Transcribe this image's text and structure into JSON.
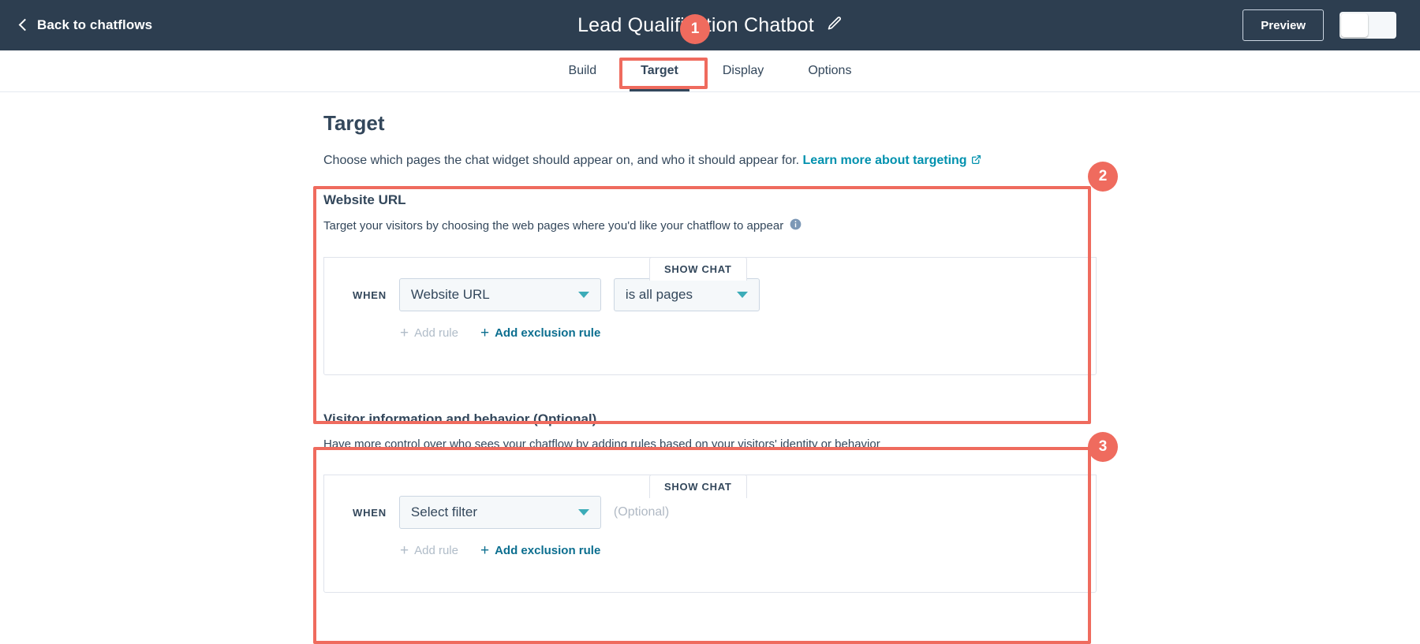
{
  "header": {
    "back_label": "Back to chatflows",
    "back_icon": "chevron-left-icon",
    "title": "Lead Qualification Chatbot",
    "edit_icon": "pencil-icon",
    "preview_label": "Preview",
    "toggle_icon": "toggle-switch"
  },
  "tabs": [
    {
      "label": "Build",
      "active": false
    },
    {
      "label": "Target",
      "active": true
    },
    {
      "label": "Display",
      "active": false
    },
    {
      "label": "Options",
      "active": false
    }
  ],
  "main": {
    "page_title": "Target",
    "description_text": "Choose which pages the chat widget should appear on, and who it should appear for.",
    "description_link": "Learn more about targeting",
    "external_link_icon": "external-link-icon"
  },
  "website_url_section": {
    "title": "Website URL",
    "description": "Target your visitors by choosing the web pages where you'd like your chatflow to appear",
    "info_icon": "info-icon",
    "show_chat_tab": "SHOW CHAT",
    "when_label": "WHEN",
    "filter_value": "Website URL",
    "operator_value": "is all pages",
    "caret_icon": "chevron-down-icon",
    "add_rule_label": "Add rule",
    "add_exclusion_label": "Add exclusion rule",
    "plus_icon": "plus-icon"
  },
  "visitor_section": {
    "title": "Visitor information and behavior (Optional)",
    "description": "Have more control over who sees your chatflow by adding rules based on your visitors' identity or behavior",
    "show_chat_tab": "SHOW CHAT",
    "when_label": "WHEN",
    "filter_value": "Select filter",
    "optional_text": "(Optional)",
    "caret_icon": "chevron-down-icon",
    "add_rule_label": "Add rule",
    "add_exclusion_label": "Add exclusion rule",
    "plus_icon": "plus-icon"
  },
  "annotations": {
    "accent_color": "#ef6b5e",
    "badges": [
      {
        "number": "1"
      },
      {
        "number": "2"
      },
      {
        "number": "3"
      }
    ]
  },
  "colors": {
    "header_bg": "#2d3e50",
    "text_primary": "#33475b",
    "link": "#0091ae",
    "caret_teal": "#3cacb8",
    "annotation_red": "#ef6b5e"
  }
}
